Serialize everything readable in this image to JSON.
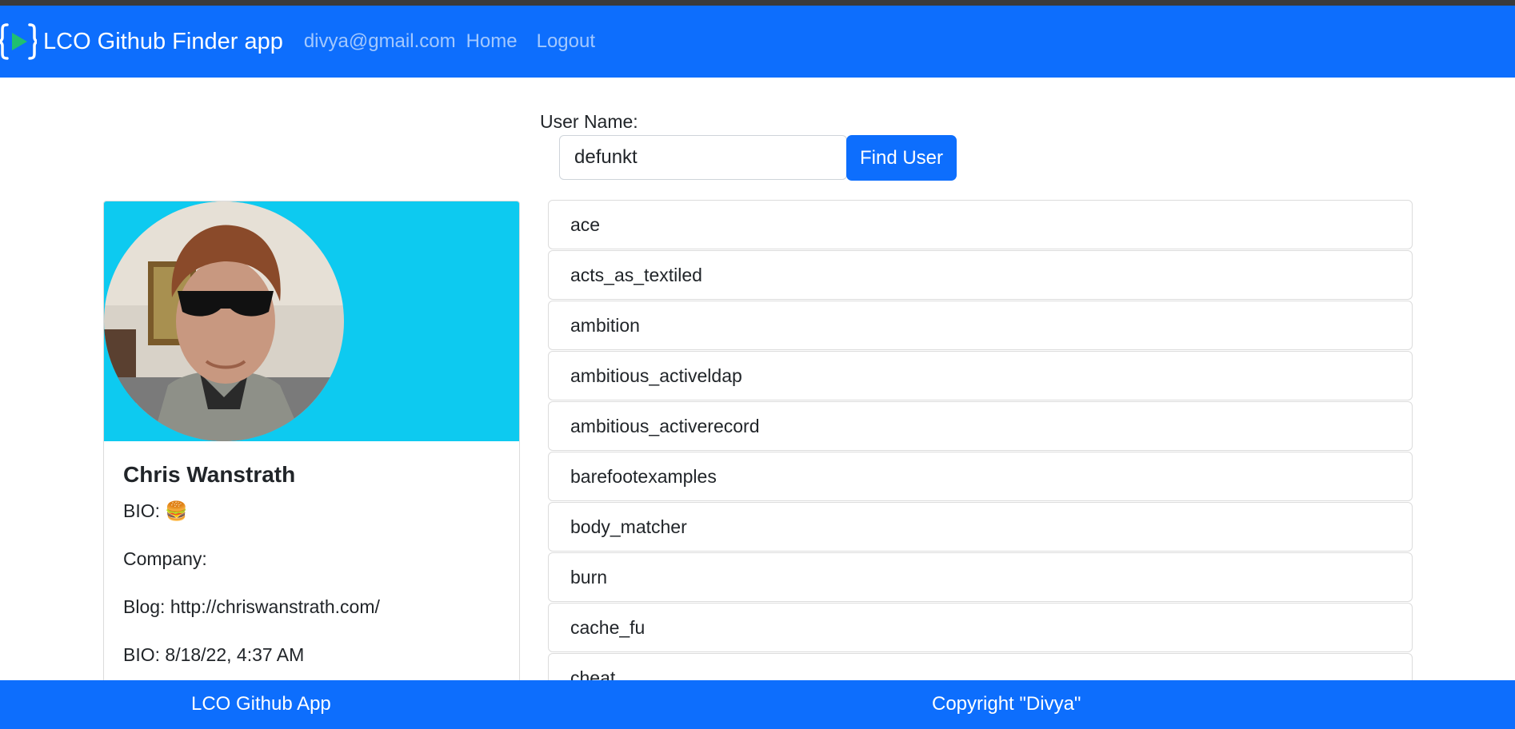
{
  "navbar": {
    "brand_text": "LCO Github Finder app",
    "email": "divya@gmail.com",
    "home_label": "Home",
    "logout_label": "Logout",
    "logo_icon": "brackets-play-icon"
  },
  "search": {
    "label": "User Name:",
    "value": "defunkt",
    "button_label": "Find User"
  },
  "profile": {
    "avatar_icon": "user-avatar-photo",
    "name": "Chris Wanstrath",
    "bio_label": "BIO:",
    "bio_value": "🍔",
    "company_label": "Company:",
    "company_value": "",
    "blog_label": "Blog:",
    "blog_value": "http://chriswanstrath.com/",
    "date_label": "BIO:",
    "date_value": "8/18/22, 4:37 AM"
  },
  "repos": [
    "ace",
    "acts_as_textiled",
    "ambition",
    "ambitious_activeldap",
    "ambitious_activerecord",
    "barefootexamples",
    "body_matcher",
    "burn",
    "cache_fu",
    "cheat"
  ],
  "footer": {
    "left": "LCO Github App",
    "right": "Copyright \"Divya\""
  },
  "colors": {
    "primary": "#0d6efd",
    "info": "#0dcaf0",
    "logo_green": "#20c070"
  }
}
